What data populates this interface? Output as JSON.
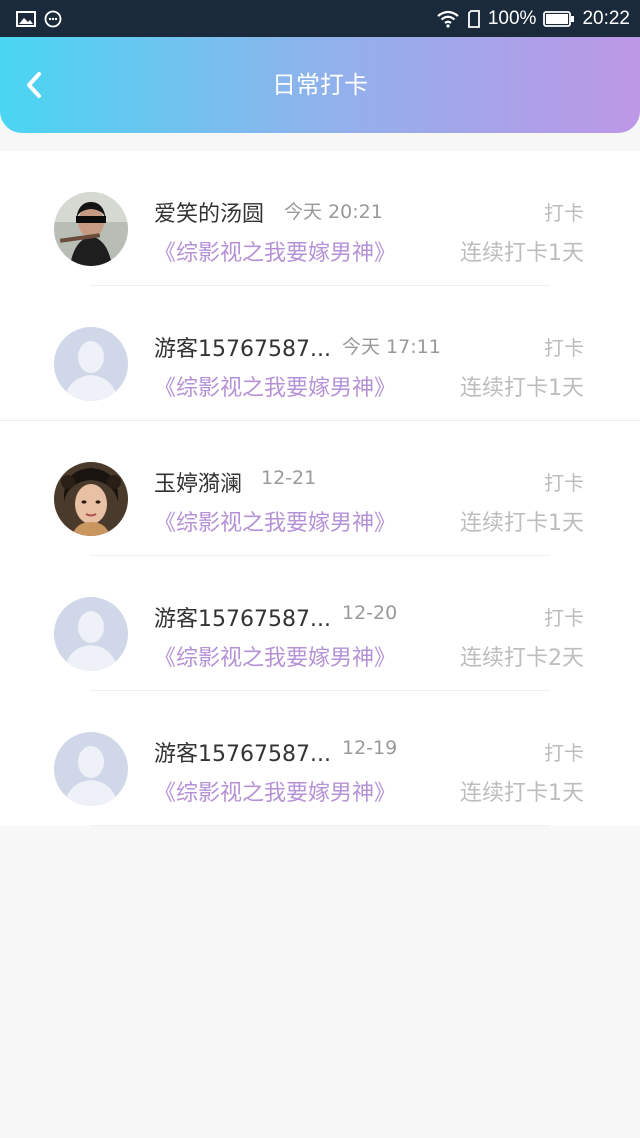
{
  "status_bar": {
    "battery": "100%",
    "time": "20:22",
    "icons": [
      "image-icon",
      "chat-icon",
      "wifi-icon",
      "sim-icon",
      "battery-icon"
    ]
  },
  "header": {
    "title": "日常打卡",
    "back_icon": "chevron-left-icon",
    "gradient": [
      "#49d6f2",
      "#8fb2ec",
      "#bd97e6"
    ]
  },
  "checkins": [
    {
      "name": "爱笑的汤圆",
      "time": "今天 20:21",
      "book": "《综影视之我要嫁男神》",
      "tag": "打卡",
      "streak": "连续打卡1天",
      "avatar": "photo-avatar-blindfold"
    },
    {
      "name": "游客15767587...",
      "time": "今天 17:11",
      "book": "《综影视之我要嫁男神》",
      "tag": "打卡",
      "streak": "连续打卡1天",
      "avatar": "default-avatar"
    },
    {
      "name": "玉婷漪澜",
      "time": "12-21",
      "book": "《综影视之我要嫁男神》",
      "tag": "打卡",
      "streak": "连续打卡1天",
      "avatar": "photo-avatar-portrait"
    },
    {
      "name": "游客15767587...",
      "time": "12-20",
      "book": "《综影视之我要嫁男神》",
      "tag": "打卡",
      "streak": "连续打卡2天",
      "avatar": "default-avatar"
    },
    {
      "name": "游客15767587...",
      "time": "12-19",
      "book": "《综影视之我要嫁男神》",
      "tag": "打卡",
      "streak": "连续打卡1天",
      "avatar": "default-avatar"
    }
  ],
  "colors": {
    "book_title": "#b592d6",
    "muted": "#bdbdbd"
  }
}
